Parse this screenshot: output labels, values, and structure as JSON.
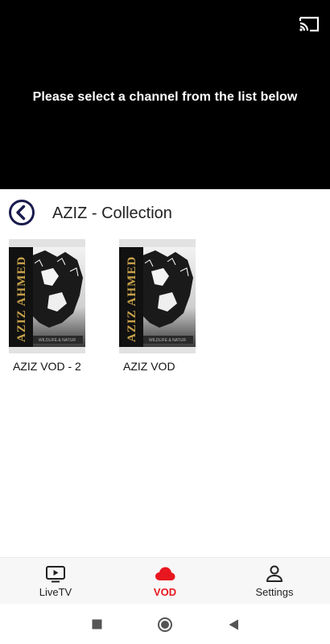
{
  "player": {
    "message": "Please select a channel from the list below",
    "cast_icon": "cast-icon"
  },
  "collection": {
    "back_icon": "chevron-left-circle-icon",
    "title": "AZIZ - Collection"
  },
  "vod_items": [
    {
      "label": "AZIZ VOD - 2",
      "poster_text": "AZIZ AHMED",
      "poster_subtext": "WILDLIFE & NATUR"
    },
    {
      "label": "AZIZ VOD",
      "poster_text": "AZIZ AHMED",
      "poster_subtext": "WILDLIFE & NATUR"
    }
  ],
  "bottom_nav": {
    "items": [
      {
        "label": "LiveTV",
        "icon": "tv-icon",
        "active": false
      },
      {
        "label": "VOD",
        "icon": "cloud-icon",
        "active": true
      },
      {
        "label": "Settings",
        "icon": "person-icon",
        "active": false
      }
    ]
  },
  "system_nav": {
    "recents_icon": "square-icon",
    "home_icon": "circle-icon",
    "back_icon": "triangle-left-icon"
  },
  "colors": {
    "accent": "#e8171f",
    "back_button": "#1a1a4e",
    "player_bg": "#000000"
  }
}
